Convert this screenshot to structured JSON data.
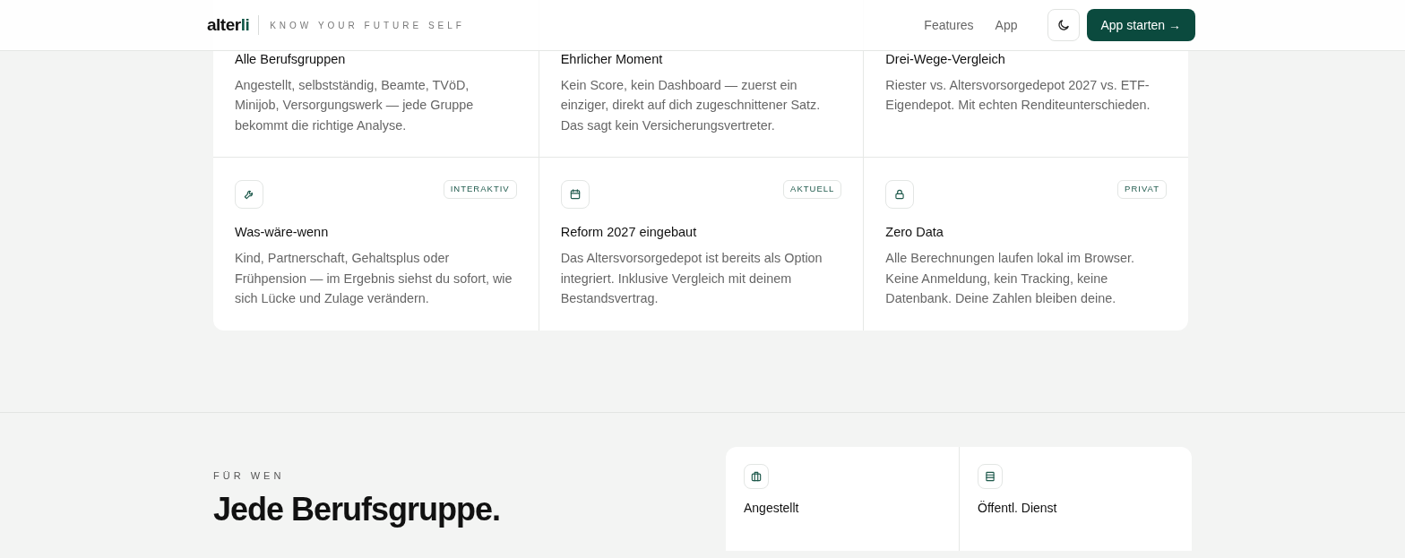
{
  "header": {
    "logo": {
      "main": "alter",
      "accent": "li"
    },
    "tagline": "KNOW YOUR FUTURE SELF",
    "nav": [
      {
        "label": "Features"
      },
      {
        "label": "App"
      }
    ],
    "cta": "App starten →"
  },
  "features": [
    {
      "title": "Alle Berufsgruppen",
      "text": "Angestellt, selbstständig, Beamte, TVöD, Minijob, Versorgungswerk — jede Gruppe bekommt die richtige Analyse."
    },
    {
      "title": "Ehrlicher Moment",
      "text": "Kein Score, kein Dashboard — zuerst ein einziger, direkt auf dich zugeschnittener Satz. Das sagt kein Versicherungsvertreter."
    },
    {
      "title": "Drei-Wege-Vergleich",
      "text": "Riester vs. Altersvorsorgedepot 2027 vs. ETF-Eigendepot. Mit echten Renditeunterschieden."
    },
    {
      "badge": "INTERAKTIV",
      "title": "Was-wäre-wenn",
      "text": "Kind, Partnerschaft, Gehaltsplus oder Frühpension — im Ergebnis siehst du sofort, wie sich Lücke und Zulage verändern."
    },
    {
      "badge": "AKTUELL",
      "title": "Reform 2027 eingebaut",
      "text": "Das Altersvorsorgedepot ist bereits als Option integriert. Inklusive Vergleich mit deinem Bestandsvertrag."
    },
    {
      "badge": "PRIVAT",
      "title": "Zero Data",
      "text": "Alle Berechnungen laufen lokal im Browser. Keine Anmeldung, kein Tracking, keine Datenbank. Deine Zahlen bleiben deine."
    }
  ],
  "audience": {
    "eyebrow": "FÜR WEN",
    "heading": "Jede Berufsgruppe.",
    "groups": [
      {
        "title": "Angestellt"
      },
      {
        "title": "Öffentl. Dienst"
      }
    ]
  }
}
